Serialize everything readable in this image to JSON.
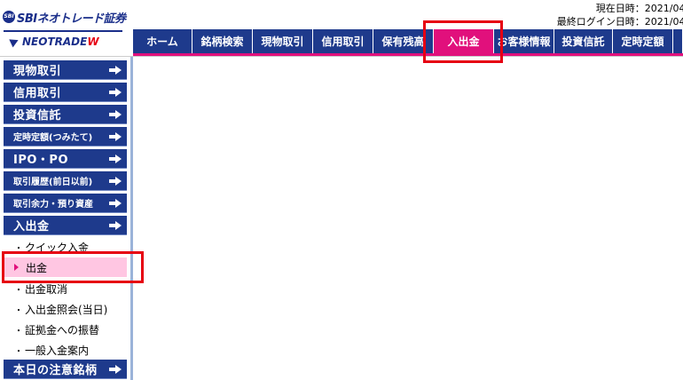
{
  "header": {
    "logo_sbi": "SBIネオトレード証券",
    "logo_badge": "SBI",
    "logo_neotrade": "NEOTRADE",
    "logo_mark": "W",
    "current_datetime": "現在日時：2021/04,",
    "last_login": "最終ログイン日時：2021/04,"
  },
  "nav": {
    "tabs": [
      {
        "label": "ホーム"
      },
      {
        "label": "銘柄検索"
      },
      {
        "label": "現物取引"
      },
      {
        "label": "信用取引"
      },
      {
        "label": "保有残高"
      },
      {
        "label": "入出金"
      },
      {
        "label": "お客様情報"
      },
      {
        "label": "投資信託"
      },
      {
        "label": "定時定額"
      }
    ],
    "active_color": "#e1107c",
    "tab_color": "#1e3a8c"
  },
  "sidebar": {
    "buttons": [
      {
        "label": "現物取引"
      },
      {
        "label": "信用取引"
      },
      {
        "label": "投資信託"
      },
      {
        "label": "定時定額(つみたて)"
      },
      {
        "label": "IPO・PO"
      },
      {
        "label": "取引履歴(前日以前)"
      },
      {
        "label": "取引余力・預り資産"
      },
      {
        "label": "入出金"
      }
    ],
    "sub_items": [
      {
        "label": "クイック入金"
      },
      {
        "label": "出金"
      },
      {
        "label": "出金取消"
      },
      {
        "label": "入出金照会(当日)"
      },
      {
        "label": "証拠金への振替"
      },
      {
        "label": "一般入金案内"
      }
    ],
    "bottom_button": {
      "label": "本日の注意銘柄"
    },
    "bullet": "・"
  },
  "annotations": {
    "highlight_color": "#e60012"
  }
}
